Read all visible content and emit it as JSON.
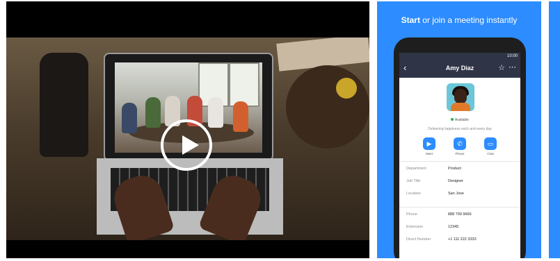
{
  "promo": {
    "title_bold": "Start",
    "title_rest": " or join a meeting instantly",
    "phone": {
      "status_time": "10:00",
      "header": {
        "back_icon": "back-arrow-icon",
        "name": "Amy Diaz",
        "star_icon": "star-icon",
        "more_icon": "more-icon"
      },
      "presence": "Available",
      "tagline": "Delivering happiness each and every day",
      "actions": [
        {
          "label": "Meet",
          "icon": "video-icon"
        },
        {
          "label": "Phone",
          "icon": "phone-icon"
        },
        {
          "label": "Chat",
          "icon": "chat-icon"
        }
      ],
      "info": [
        {
          "key": "Department",
          "value": "Product"
        },
        {
          "key": "Job Title",
          "value": "Designer"
        },
        {
          "key": "Location",
          "value": "San Jose"
        }
      ],
      "contact": [
        {
          "key": "Phone",
          "value": "888 799 9666"
        },
        {
          "key": "Extension",
          "value": "12345"
        },
        {
          "key": "Direct Number",
          "value": "+1 111 222 3333"
        }
      ]
    }
  },
  "video": {
    "play_icon": "play-icon"
  },
  "colors": {
    "brand": "#2d8cff",
    "appbar": "#2f3547",
    "available": "#2db04a"
  }
}
